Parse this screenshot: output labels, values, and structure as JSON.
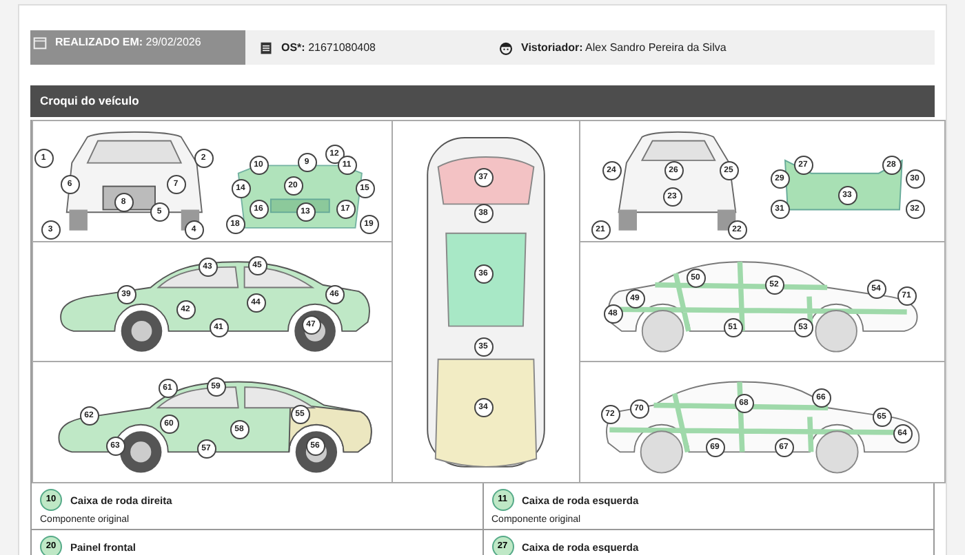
{
  "info_bar": [
    {
      "kind": "date",
      "label": "REALIZADO EM:",
      "value": "29/02/2026"
    },
    {
      "kind": "order",
      "label": "OS*:",
      "value": "21671080408"
    },
    {
      "kind": "inspector",
      "label": "Vistoriador:",
      "value": "Alex Sandro Pereira da Silva"
    }
  ],
  "section": {
    "title": "Croqui do veículo"
  },
  "panels": [
    {
      "kind": "front",
      "markers": [
        "1",
        "2",
        "6",
        "7",
        "8",
        "5",
        "3",
        "4",
        "10",
        "9",
        "12",
        "11",
        "14",
        "20",
        "15",
        "16",
        "13",
        "17",
        "18",
        "19"
      ]
    },
    {
      "kind": "top",
      "markers": [
        "37",
        "38",
        "36",
        "35",
        "34"
      ]
    },
    {
      "kind": "rear",
      "markers": [
        "24",
        "26",
        "25",
        "23",
        "21",
        "22",
        "27",
        "28",
        "29",
        "30",
        "33",
        "31",
        "32"
      ]
    },
    {
      "kind": "left-upper",
      "markers": [
        "43",
        "45",
        "39",
        "42",
        "44",
        "46",
        "47",
        "41"
      ]
    },
    {
      "kind": "right-upper",
      "markers": [
        "50",
        "52",
        "49",
        "54",
        "71",
        "48",
        "51",
        "53"
      ]
    },
    {
      "kind": "left-lower",
      "markers": [
        "61",
        "59",
        "62",
        "60",
        "58",
        "55",
        "63",
        "57",
        "56"
      ]
    },
    {
      "kind": "right-lower",
      "markers": [
        "68",
        "66",
        "70",
        "72",
        "65",
        "64",
        "69",
        "67"
      ]
    }
  ],
  "details": [
    {
      "number": "10",
      "name": "Caixa de roda direita",
      "status": "Componente original"
    },
    {
      "number": "11",
      "name": "Caixa de roda esquerda",
      "status": "Componente original"
    },
    {
      "number": "20",
      "name": "Painel frontal"
    },
    {
      "number": "27",
      "name": "Caixa de roda esquerda"
    }
  ]
}
